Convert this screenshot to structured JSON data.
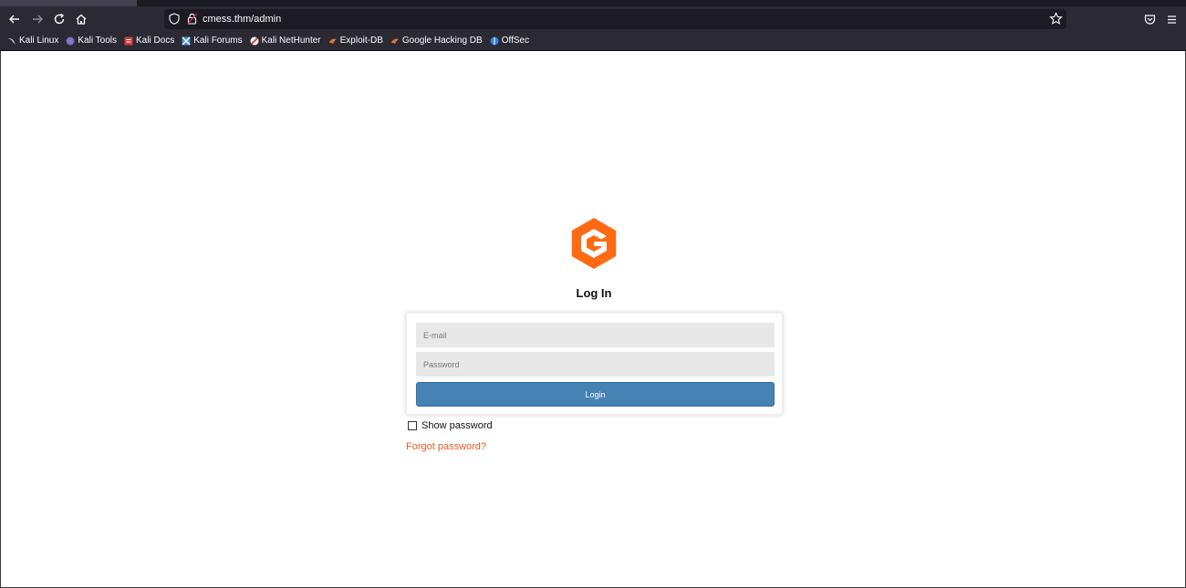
{
  "browser": {
    "url": "cmess.thm/admin",
    "bookmarks": [
      {
        "label": "Kali Linux",
        "icon": "kali-dragon-icon",
        "color": "#cccccc"
      },
      {
        "label": "Kali Tools",
        "icon": "kali-tools-icon",
        "color": "#5a7bd8"
      },
      {
        "label": "Kali Docs",
        "icon": "kali-docs-icon",
        "color": "#d63a3a"
      },
      {
        "label": "Kali Forums",
        "icon": "kali-forums-icon",
        "color": "#4a90d9"
      },
      {
        "label": "Kali NetHunter",
        "icon": "kali-nethunter-icon",
        "color": "#d64545"
      },
      {
        "label": "Exploit-DB",
        "icon": "exploit-db-icon",
        "color": "#e0783a"
      },
      {
        "label": "Google Hacking DB",
        "icon": "ghdb-icon",
        "color": "#e0783a"
      },
      {
        "label": "OffSec",
        "icon": "offsec-icon",
        "color": "#3b7ddd"
      }
    ]
  },
  "login": {
    "title": "Log In",
    "email_placeholder": "E-mail",
    "password_placeholder": "Password",
    "login_label": "Login",
    "show_password_label": "Show password",
    "forgot_label": "Forgot password?"
  },
  "colors": {
    "brand_orange": "#ff6a13",
    "button_blue": "#4682b4",
    "link_orange": "#f05a24"
  }
}
